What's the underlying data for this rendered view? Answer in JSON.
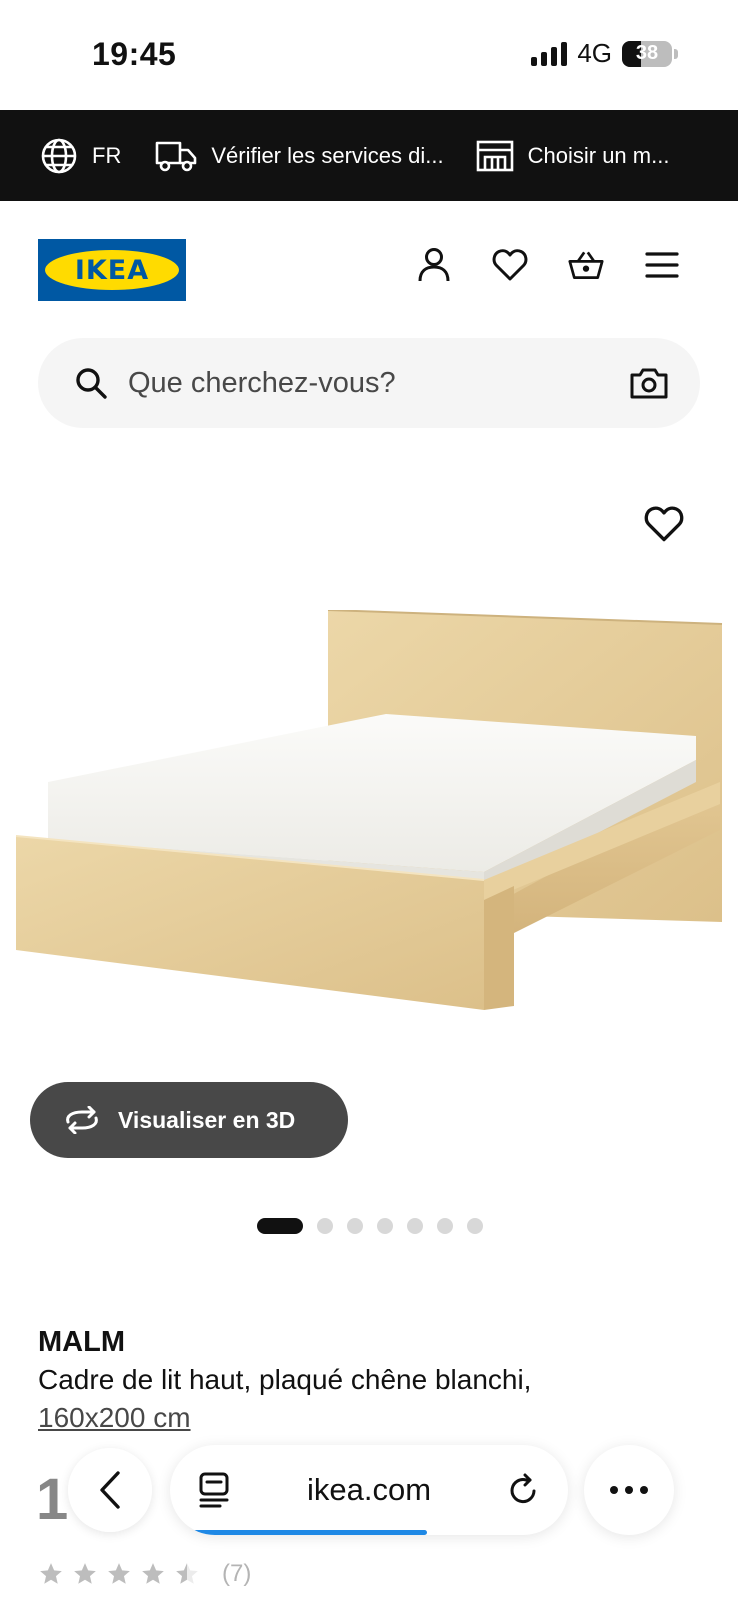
{
  "status_bar": {
    "time": "19:45",
    "network": "4G",
    "battery": "38",
    "battery_level": 0.38
  },
  "top_bar": {
    "language": "FR",
    "delivery": "Vérifier les services di...",
    "store": "Choisir un m..."
  },
  "header": {
    "logo_text": "IKEA",
    "icons": [
      "user-icon",
      "heart-icon",
      "basket-icon",
      "menu-icon"
    ]
  },
  "search": {
    "placeholder": "Que cherchez-vous?"
  },
  "gallery": {
    "view_3d_label": "Visualiser en 3D",
    "image_count": 7,
    "active_index": 0
  },
  "product": {
    "name": "MALM",
    "description": "Cadre de lit haut, plaqué chêne blanchi,",
    "size": "160x200 cm",
    "price_visible": "1",
    "rating_stars": 4.5,
    "rating_count": "(7)"
  },
  "browser": {
    "url": "ikea.com",
    "load_progress": 0.6
  },
  "colors": {
    "ikea_blue": "#0058a3",
    "ikea_yellow": "#ffdb00",
    "top_bar_bg": "#111111",
    "button_dark": "#484848",
    "progress_blue": "#1e88e5"
  }
}
